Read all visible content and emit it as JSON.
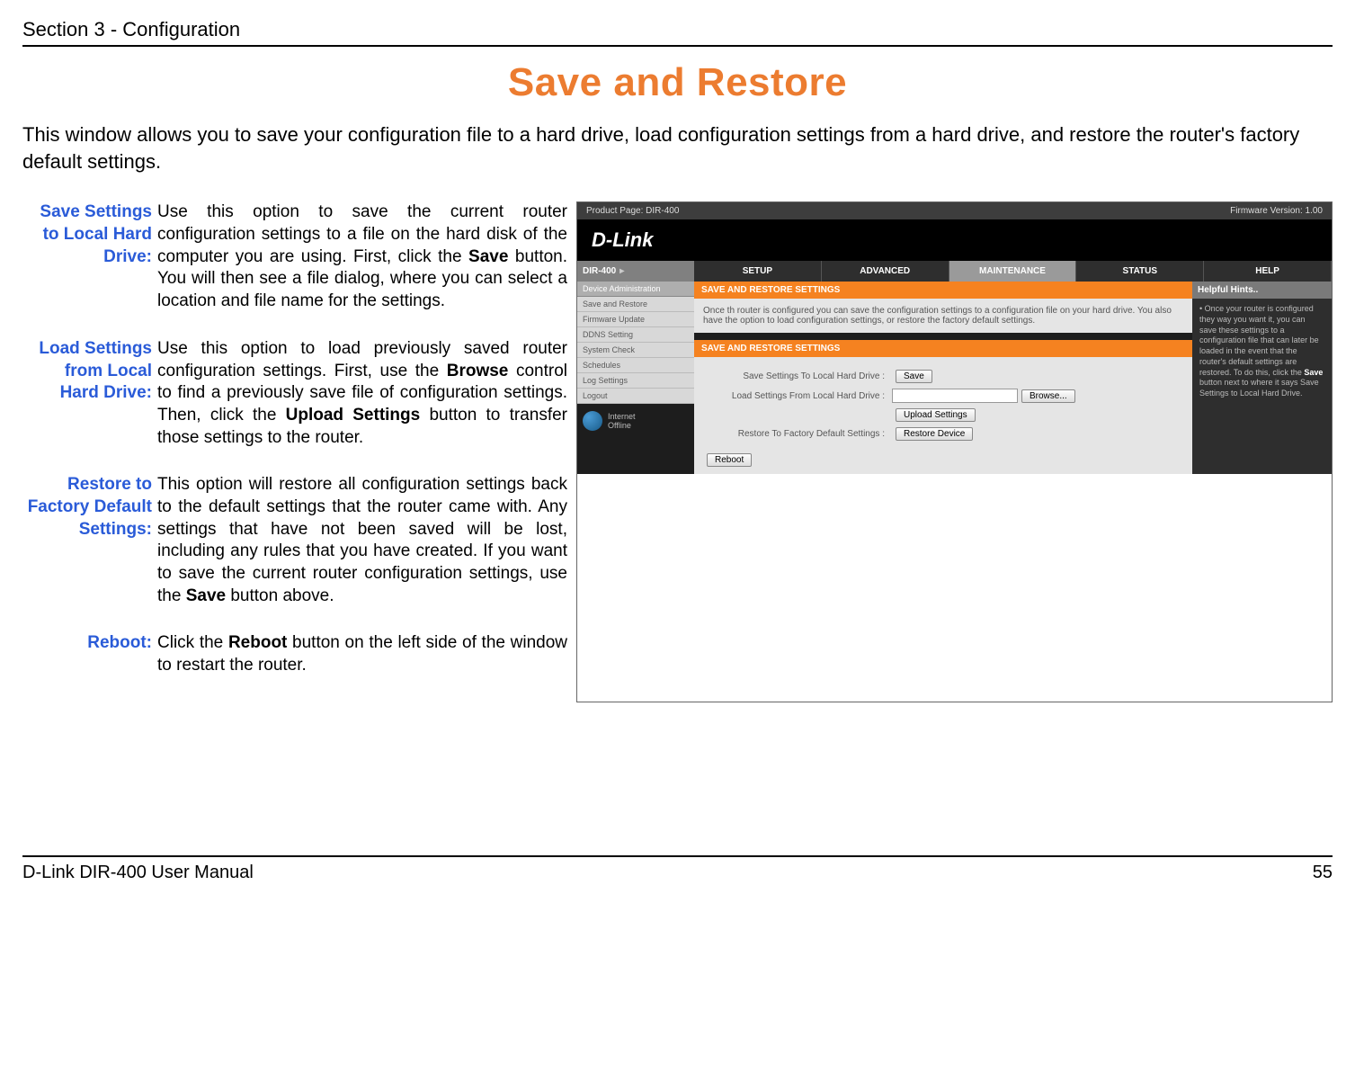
{
  "header": {
    "section": "Section 3 - Configuration"
  },
  "title": "Save and Restore",
  "intro": "This window allows you to save your configuration file to a hard drive, load configuration settings from a hard drive, and restore the router's factory default settings.",
  "defs": {
    "save": {
      "label1": "Save Settings",
      "label2": "to Local Hard",
      "label3": "Drive:",
      "b1": "Use this option to save the current router configuration settings to a file on the hard disk of the computer you are using. First, click the ",
      "bold1": "Save",
      "b2": " button. You will then see a file dialog, where you can select a location and file name for the settings."
    },
    "load": {
      "label1": "Load Settings",
      "label2": "from Local",
      "label3": "Hard Drive:",
      "b1": "Use this option to load previously saved router configuration settings. First, use the ",
      "bold1": "Browse",
      "b2": " control to find a previously save file of configuration settings. Then, click the ",
      "bold2": "Upload Settings",
      "b3": " button to transfer those settings to the router."
    },
    "restore": {
      "label1": "Restore to",
      "label2": "Factory Default",
      "label3": "Settings:",
      "b1": "This option will restore all configuration settings back to the default settings that the router came with. Any settings that have not been saved will be lost, including any rules that you have created. If you want to save the current router configuration settings, use the ",
      "bold1": "Save",
      "b2": " button above."
    },
    "reboot": {
      "label": "Reboot:",
      "b1": "Click the ",
      "bold1": "Reboot",
      "b2": " button on the left side of the window to restart the router."
    }
  },
  "screenshot": {
    "productLabel": "Product Page:",
    "productModel": "DIR-400",
    "fwLabel": "Firmware Version: 1.00",
    "logo": "D-Link",
    "crumb": "DIR-400",
    "tabs": {
      "setup": "SETUP",
      "advanced": "ADVANCED",
      "maintenance": "MAINTENANCE",
      "status": "STATUS",
      "help": "HELP"
    },
    "sidebar": {
      "title": "Device Administration",
      "items": [
        "Save and Restore",
        "Firmware Update",
        "DDNS Setting",
        "System Check",
        "Schedules",
        "Log Settings",
        "Logout"
      ],
      "internet1": "Internet",
      "internet2": "Offline"
    },
    "panel1": {
      "title": "SAVE AND RESTORE SETTINGS",
      "body": "Once th router is configured you can save the configuration settings to a configuration file on your hard drive. You also have the option to load configuration settings, or restore the factory default settings."
    },
    "panel2": {
      "title": "SAVE AND RESTORE SETTINGS",
      "row1": "Save Settings To Local Hard Drive :",
      "btnSave": "Save",
      "row2": "Load Settings From Local Hard Drive :",
      "btnBrowse": "Browse...",
      "btnUpload": "Upload Settings",
      "row3": "Restore To Factory Default Settings :",
      "btnRestore": "Restore Device",
      "btnReboot": "Reboot"
    },
    "hints": {
      "title": "Helpful Hints..",
      "body1": "• Once your router is configured they way you want it, you can save these settings to a configuration file that can later be loaded in the event that the router's default settings are restored. To do this, click the ",
      "bold": "Save",
      "body2": " button next to where it says Save Settings to Local Hard Drive."
    }
  },
  "footer": {
    "left": "D-Link DIR-400 User Manual",
    "right": "55"
  }
}
